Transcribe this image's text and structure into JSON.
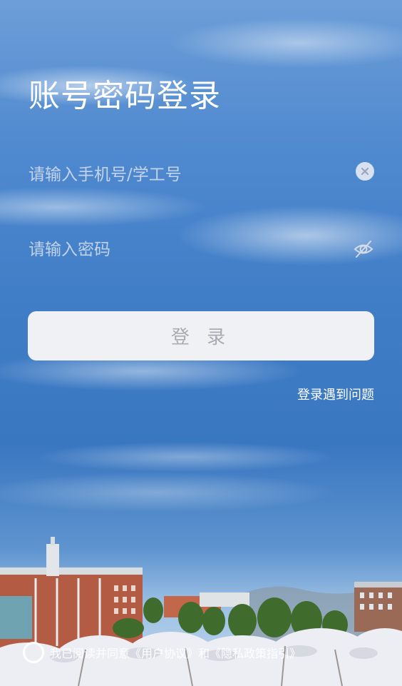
{
  "page": {
    "title": "账号密码登录"
  },
  "form": {
    "username_placeholder": "请输入手机号/学工号",
    "username_value": "",
    "password_placeholder": "请输入密码",
    "password_value": "",
    "login_label": "登 录",
    "help_link": "登录遇到问题"
  },
  "agreement": {
    "prefix": "我已阅读并同意",
    "user_agreement": "《用户协议》",
    "conjunction": "和",
    "privacy_guide": "《隐私政策指引》"
  },
  "icons": {
    "clear": "close-circle-icon",
    "password_visibility": "eye-off-icon"
  },
  "colors": {
    "button_bg": "#f0f1f5",
    "button_text": "#a9abb2",
    "sky": "#3f7dc6"
  }
}
